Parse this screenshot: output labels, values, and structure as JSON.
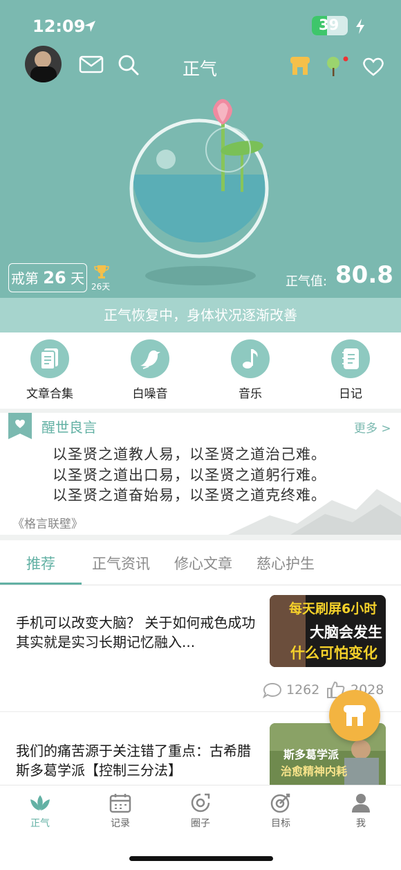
{
  "status": {
    "time": "12:09",
    "battery": "39"
  },
  "header": {
    "title": "正气"
  },
  "hero": {
    "streak_prefix": "戒第",
    "streak_days": "26",
    "streak_suffix": "天",
    "trophy_days": "26天",
    "score_label": "正气值:",
    "score_value": "80.8"
  },
  "banner": {
    "text": "正气恢复中，身体状况逐渐改善"
  },
  "quick_actions": [
    {
      "label": "文章合集",
      "icon": "document-icon"
    },
    {
      "label": "白噪音",
      "icon": "bird-icon"
    },
    {
      "label": "音乐",
      "icon": "music-note-icon"
    },
    {
      "label": "日记",
      "icon": "diary-icon"
    }
  ],
  "quote": {
    "title": "醒世良言",
    "more": "更多 >",
    "lines": [
      "以圣贤之道教人易，以圣贤之道治己难。",
      "以圣贤之道出口易，以圣贤之道躬行难。",
      "以圣贤之道奋始易，以圣贤之道克终难。"
    ],
    "source": "《格言联壁》"
  },
  "tabs": [
    "推荐",
    "正气资讯",
    "修心文章",
    "慈心护生"
  ],
  "articles": [
    {
      "title": "手机可以改变大脑？ 关于如何戒色成功其实就是实习长期记忆融入...",
      "thumb_lines": [
        "每天刷屏6小时",
        "大脑会发生",
        "什么可怕变化"
      ],
      "comments": "1262",
      "likes": "2028"
    },
    {
      "title": "我们的痛苦源于关注错了重点：古希腊斯多葛学派【控制三分法】",
      "thumb_lines": [
        "斯多葛学派",
        "治愈精神内耗"
      ]
    }
  ],
  "nav": [
    {
      "label": "正气",
      "icon": "lotus-icon"
    },
    {
      "label": "记录",
      "icon": "calendar-icon"
    },
    {
      "label": "圈子",
      "icon": "circle-icon"
    },
    {
      "label": "目标",
      "icon": "target-icon"
    },
    {
      "label": "我",
      "icon": "person-icon"
    }
  ],
  "colors": {
    "accent": "#63b1a4",
    "hero_bg": "#7bb9b0",
    "fab": "#f3b441"
  }
}
